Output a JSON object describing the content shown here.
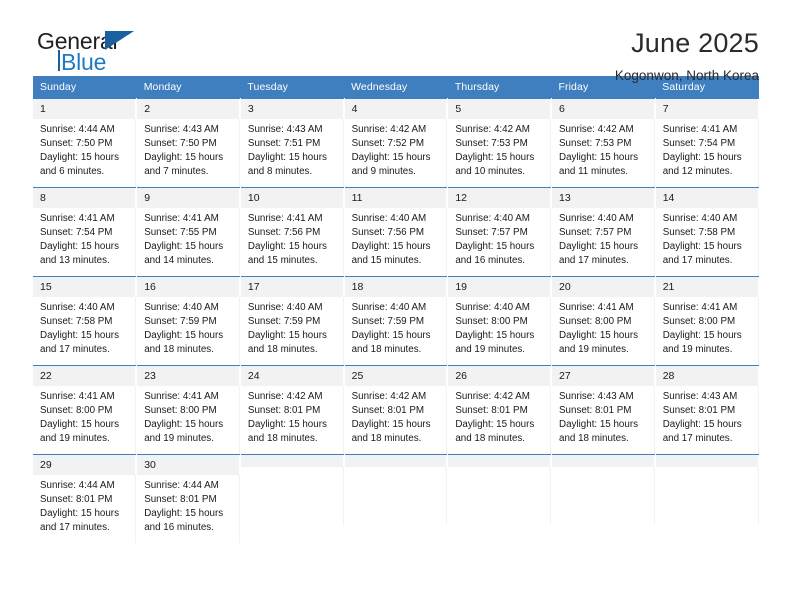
{
  "logo": {
    "primary_text": "General",
    "secondary_text": "Blue",
    "primary_color": "#231f20",
    "secondary_color": "#1f7ac4",
    "triangle_color": "#18619e"
  },
  "header": {
    "title": "June 2025",
    "subtitle": "Kogonwon, North Korea"
  },
  "theme": {
    "header_bg": "#3f7fbf",
    "header_text": "#ffffff",
    "daynum_bg": "#f2f2f2",
    "cell_bg": "#ffffff",
    "body_text": "#1a1a1a"
  },
  "calendar": {
    "weekday_headers": [
      "Sunday",
      "Monday",
      "Tuesday",
      "Wednesday",
      "Thursday",
      "Friday",
      "Saturday"
    ],
    "weeks": [
      [
        {
          "day": "1",
          "lines": [
            "Sunrise: 4:44 AM",
            "Sunset: 7:50 PM",
            "Daylight: 15 hours",
            "and 6 minutes."
          ]
        },
        {
          "day": "2",
          "lines": [
            "Sunrise: 4:43 AM",
            "Sunset: 7:50 PM",
            "Daylight: 15 hours",
            "and 7 minutes."
          ]
        },
        {
          "day": "3",
          "lines": [
            "Sunrise: 4:43 AM",
            "Sunset: 7:51 PM",
            "Daylight: 15 hours",
            "and 8 minutes."
          ]
        },
        {
          "day": "4",
          "lines": [
            "Sunrise: 4:42 AM",
            "Sunset: 7:52 PM",
            "Daylight: 15 hours",
            "and 9 minutes."
          ]
        },
        {
          "day": "5",
          "lines": [
            "Sunrise: 4:42 AM",
            "Sunset: 7:53 PM",
            "Daylight: 15 hours",
            "and 10 minutes."
          ]
        },
        {
          "day": "6",
          "lines": [
            "Sunrise: 4:42 AM",
            "Sunset: 7:53 PM",
            "Daylight: 15 hours",
            "and 11 minutes."
          ]
        },
        {
          "day": "7",
          "lines": [
            "Sunrise: 4:41 AM",
            "Sunset: 7:54 PM",
            "Daylight: 15 hours",
            "and 12 minutes."
          ]
        }
      ],
      [
        {
          "day": "8",
          "lines": [
            "Sunrise: 4:41 AM",
            "Sunset: 7:54 PM",
            "Daylight: 15 hours",
            "and 13 minutes."
          ]
        },
        {
          "day": "9",
          "lines": [
            "Sunrise: 4:41 AM",
            "Sunset: 7:55 PM",
            "Daylight: 15 hours",
            "and 14 minutes."
          ]
        },
        {
          "day": "10",
          "lines": [
            "Sunrise: 4:41 AM",
            "Sunset: 7:56 PM",
            "Daylight: 15 hours",
            "and 15 minutes."
          ]
        },
        {
          "day": "11",
          "lines": [
            "Sunrise: 4:40 AM",
            "Sunset: 7:56 PM",
            "Daylight: 15 hours",
            "and 15 minutes."
          ]
        },
        {
          "day": "12",
          "lines": [
            "Sunrise: 4:40 AM",
            "Sunset: 7:57 PM",
            "Daylight: 15 hours",
            "and 16 minutes."
          ]
        },
        {
          "day": "13",
          "lines": [
            "Sunrise: 4:40 AM",
            "Sunset: 7:57 PM",
            "Daylight: 15 hours",
            "and 17 minutes."
          ]
        },
        {
          "day": "14",
          "lines": [
            "Sunrise: 4:40 AM",
            "Sunset: 7:58 PM",
            "Daylight: 15 hours",
            "and 17 minutes."
          ]
        }
      ],
      [
        {
          "day": "15",
          "lines": [
            "Sunrise: 4:40 AM",
            "Sunset: 7:58 PM",
            "Daylight: 15 hours",
            "and 17 minutes."
          ]
        },
        {
          "day": "16",
          "lines": [
            "Sunrise: 4:40 AM",
            "Sunset: 7:59 PM",
            "Daylight: 15 hours",
            "and 18 minutes."
          ]
        },
        {
          "day": "17",
          "lines": [
            "Sunrise: 4:40 AM",
            "Sunset: 7:59 PM",
            "Daylight: 15 hours",
            "and 18 minutes."
          ]
        },
        {
          "day": "18",
          "lines": [
            "Sunrise: 4:40 AM",
            "Sunset: 7:59 PM",
            "Daylight: 15 hours",
            "and 18 minutes."
          ]
        },
        {
          "day": "19",
          "lines": [
            "Sunrise: 4:40 AM",
            "Sunset: 8:00 PM",
            "Daylight: 15 hours",
            "and 19 minutes."
          ]
        },
        {
          "day": "20",
          "lines": [
            "Sunrise: 4:41 AM",
            "Sunset: 8:00 PM",
            "Daylight: 15 hours",
            "and 19 minutes."
          ]
        },
        {
          "day": "21",
          "lines": [
            "Sunrise: 4:41 AM",
            "Sunset: 8:00 PM",
            "Daylight: 15 hours",
            "and 19 minutes."
          ]
        }
      ],
      [
        {
          "day": "22",
          "lines": [
            "Sunrise: 4:41 AM",
            "Sunset: 8:00 PM",
            "Daylight: 15 hours",
            "and 19 minutes."
          ]
        },
        {
          "day": "23",
          "lines": [
            "Sunrise: 4:41 AM",
            "Sunset: 8:00 PM",
            "Daylight: 15 hours",
            "and 19 minutes."
          ]
        },
        {
          "day": "24",
          "lines": [
            "Sunrise: 4:42 AM",
            "Sunset: 8:01 PM",
            "Daylight: 15 hours",
            "and 18 minutes."
          ]
        },
        {
          "day": "25",
          "lines": [
            "Sunrise: 4:42 AM",
            "Sunset: 8:01 PM",
            "Daylight: 15 hours",
            "and 18 minutes."
          ]
        },
        {
          "day": "26",
          "lines": [
            "Sunrise: 4:42 AM",
            "Sunset: 8:01 PM",
            "Daylight: 15 hours",
            "and 18 minutes."
          ]
        },
        {
          "day": "27",
          "lines": [
            "Sunrise: 4:43 AM",
            "Sunset: 8:01 PM",
            "Daylight: 15 hours",
            "and 18 minutes."
          ]
        },
        {
          "day": "28",
          "lines": [
            "Sunrise: 4:43 AM",
            "Sunset: 8:01 PM",
            "Daylight: 15 hours",
            "and 17 minutes."
          ]
        }
      ],
      [
        {
          "day": "29",
          "lines": [
            "Sunrise: 4:44 AM",
            "Sunset: 8:01 PM",
            "Daylight: 15 hours",
            "and 17 minutes."
          ]
        },
        {
          "day": "30",
          "lines": [
            "Sunrise: 4:44 AM",
            "Sunset: 8:01 PM",
            "Daylight: 15 hours",
            "and 16 minutes."
          ]
        },
        {
          "day": "",
          "lines": []
        },
        {
          "day": "",
          "lines": []
        },
        {
          "day": "",
          "lines": []
        },
        {
          "day": "",
          "lines": []
        },
        {
          "day": "",
          "lines": []
        }
      ]
    ]
  }
}
